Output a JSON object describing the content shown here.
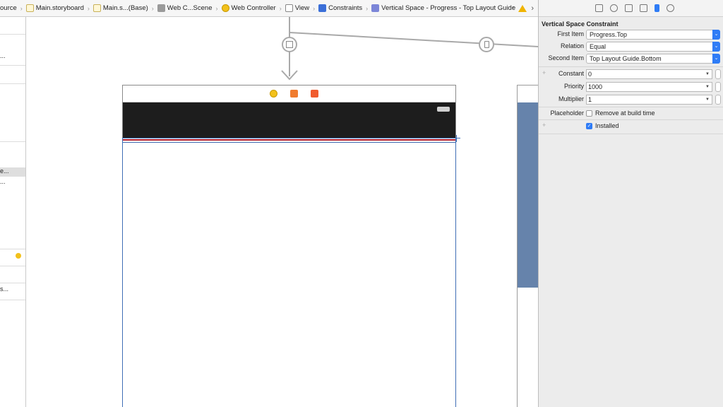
{
  "breadcrumb": [
    {
      "label": "ource",
      "icon": "folder-icon"
    },
    {
      "label": "Main.storyboard",
      "icon": "storyboard-file-icon"
    },
    {
      "label": "Main.s...(Base)",
      "icon": "storyboard-file-icon"
    },
    {
      "label": "Web C...Scene",
      "icon": "scene-icon"
    },
    {
      "label": "Web Controller",
      "icon": "view-controller-icon"
    },
    {
      "label": "View",
      "icon": "view-icon"
    },
    {
      "label": "Constraints",
      "icon": "constraints-icon"
    },
    {
      "label": "Vertical Space - Progress - Top Layout Guide",
      "icon": "constraint-icon"
    }
  ],
  "navigator": {
    "rows": [
      "...",
      "e...",
      "...",
      "s..."
    ]
  },
  "inspector": {
    "title": "Vertical Space Constraint",
    "first_item": {
      "label": "First Item",
      "value": "Progress.Top"
    },
    "relation": {
      "label": "Relation",
      "value": "Equal"
    },
    "second_item": {
      "label": "Second Item",
      "value": "Top Layout Guide.Bottom"
    },
    "constant": {
      "label": "Constant",
      "value": "0"
    },
    "priority": {
      "label": "Priority",
      "value": "1000"
    },
    "multiplier": {
      "label": "Multiplier",
      "value": "1"
    },
    "placeholder": {
      "label": "Placeholder",
      "checkbox_label": "Remove at build time",
      "checked": false
    },
    "installed": {
      "checkbox_label": "Installed",
      "checked": true
    }
  },
  "colors": {
    "accent": "#2f7cf6",
    "nav_bar": "#1d1d1d",
    "progress": "#b01a2a",
    "selection": "#3f6eb5",
    "second_scene": "#6683ab"
  }
}
